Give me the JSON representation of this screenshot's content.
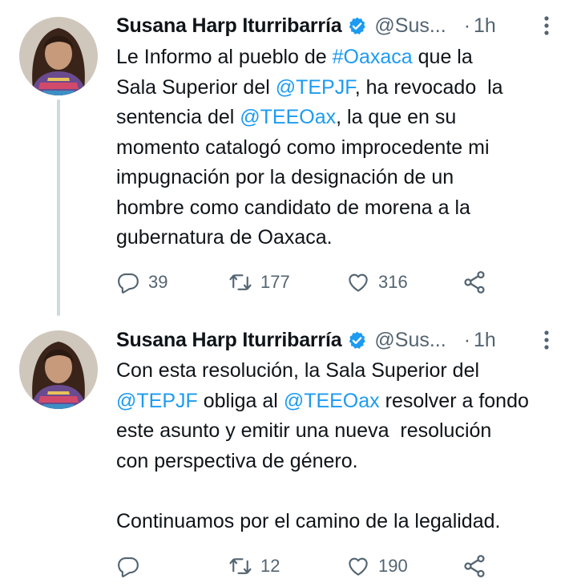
{
  "tweets": [
    {
      "author_name": "Susana Harp Iturribarría",
      "handle": "@Sus...",
      "separator": "·",
      "time": "1h",
      "lines": [
        [
          {
            "t": "Le Informo al pueblo de "
          },
          {
            "t": "#Oaxaca",
            "link": true
          },
          {
            "t": " que la"
          }
        ],
        [
          {
            "t": "Sala Superior del "
          },
          {
            "t": "@TEPJF",
            "link": true
          },
          {
            "t": ", ha revocado  la"
          }
        ],
        [
          {
            "t": "sentencia del "
          },
          {
            "t": "@TEEOax",
            "link": true
          },
          {
            "t": ", la que en su"
          }
        ],
        [
          {
            "t": "momento catalogó como improcedente mi"
          }
        ],
        [
          {
            "t": "impugnación por la designación de un"
          }
        ],
        [
          {
            "t": "hombre como candidato de morena a la"
          }
        ],
        [
          {
            "t": "gubernatura de Oaxaca."
          }
        ]
      ],
      "replies": "39",
      "retweets": "177",
      "likes": "316"
    },
    {
      "author_name": "Susana Harp Iturribarría",
      "handle": "@Sus...",
      "separator": "·",
      "time": "1h",
      "lines": [
        [
          {
            "t": "Con esta resolución, la Sala Superior del"
          }
        ],
        [
          {
            "t": "@TEPJF",
            "link": true
          },
          {
            "t": " obliga al "
          },
          {
            "t": "@TEEOax",
            "link": true
          },
          {
            "t": " resolver a fondo"
          }
        ],
        [
          {
            "t": "este asunto y emitir una nueva  resolución"
          }
        ],
        [
          {
            "t": "con perspectiva de género."
          }
        ],
        [],
        [
          {
            "t": "Continuamos por el camino de la legalidad."
          }
        ]
      ],
      "replies": "",
      "retweets": "12",
      "likes": "190"
    }
  ],
  "icons": {
    "verified": "verified-badge-icon",
    "more": "more-vertical-icon",
    "reply": "reply-icon",
    "retweet": "retweet-icon",
    "like": "heart-icon",
    "share": "share-icon"
  },
  "colors": {
    "text": "#0f1419",
    "secondary": "#536471",
    "link": "#1d9bf0",
    "verified": "#1d9bf0",
    "thread_line": "#cfd9de"
  }
}
